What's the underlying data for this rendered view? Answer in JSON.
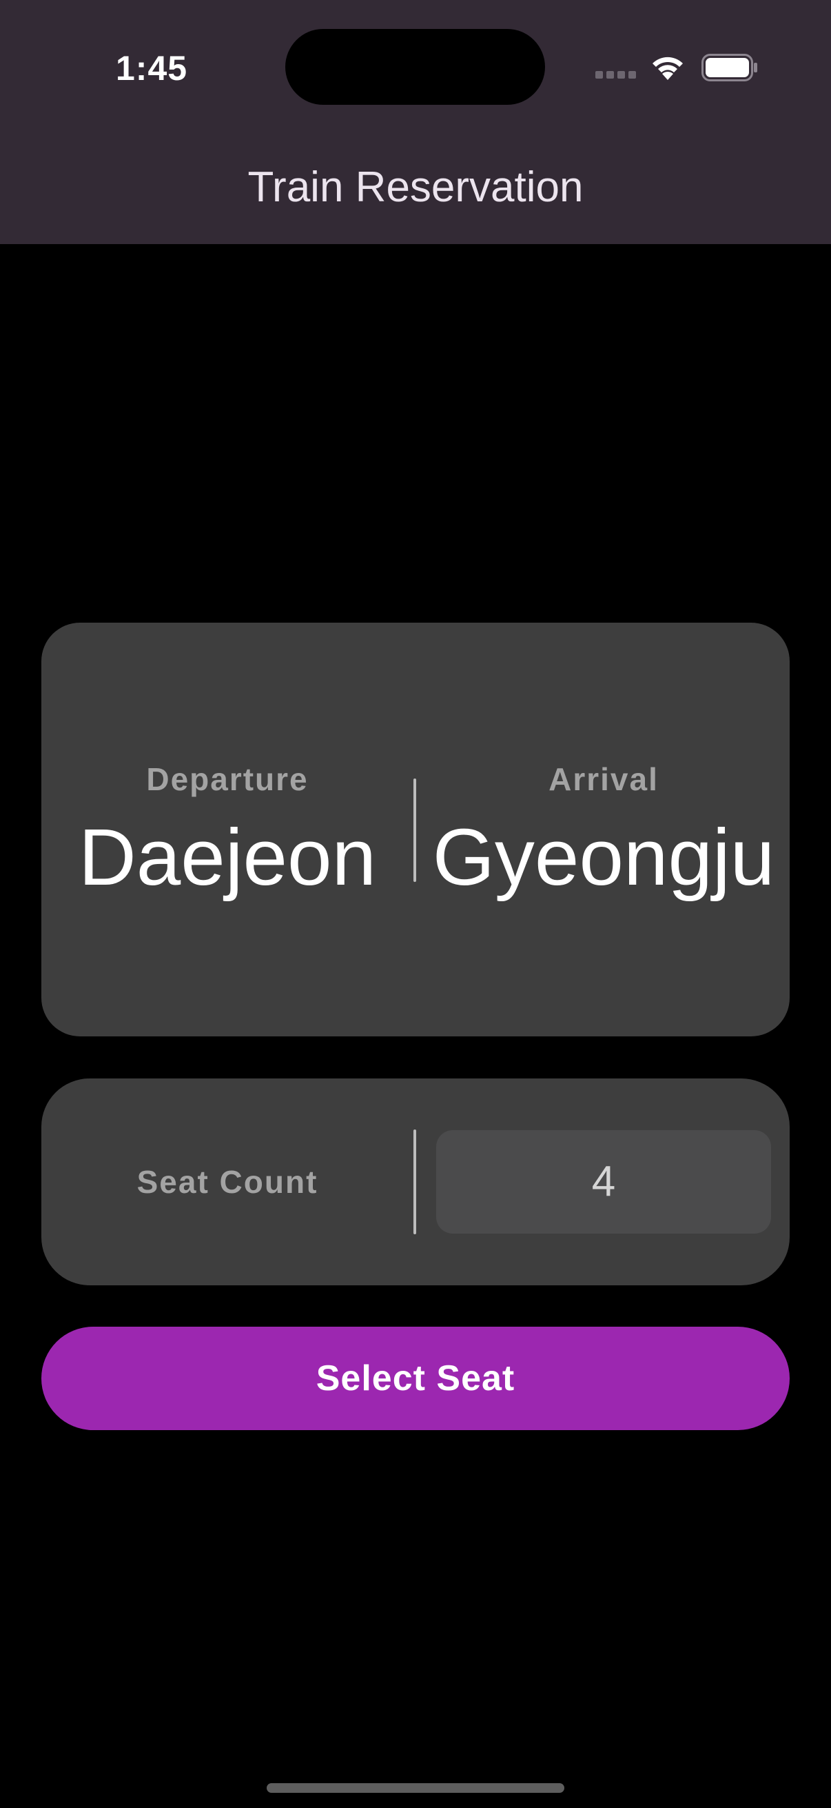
{
  "status_bar": {
    "time": "1:45",
    "icons": [
      "signal-icon",
      "wifi-icon",
      "battery-icon"
    ]
  },
  "app_bar": {
    "title": "Train Reservation"
  },
  "route": {
    "departure_label": "Departure",
    "departure_station": "Daejeon",
    "arrival_label": "Arrival",
    "arrival_station": "Gyeongju"
  },
  "seat": {
    "label": "Seat Count",
    "value": "4"
  },
  "actions": {
    "select_seat_label": "Select Seat"
  },
  "colors": {
    "app_bar_bg": "#332a35",
    "card_bg": "#3e3e3e",
    "accent": "#9c27b0",
    "background": "#000000"
  }
}
